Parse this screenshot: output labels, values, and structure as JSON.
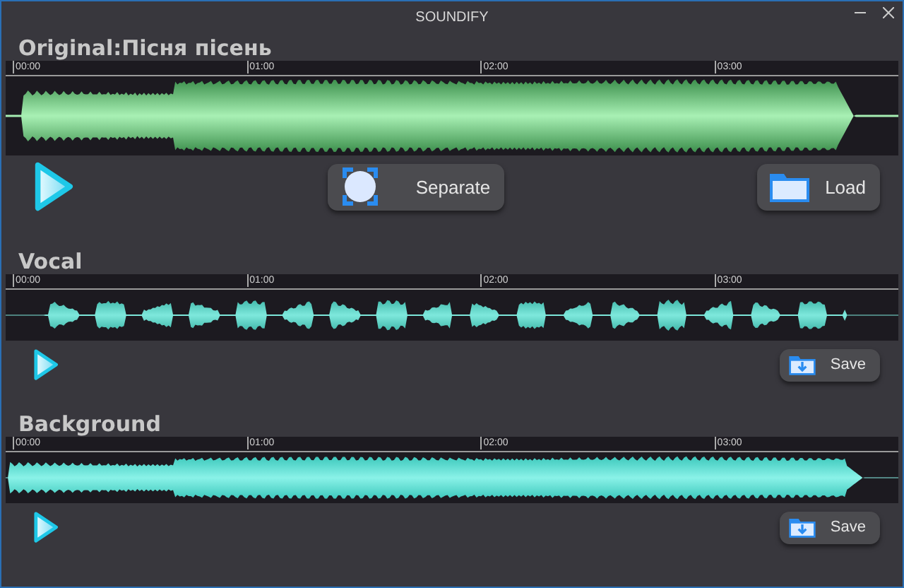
{
  "window": {
    "title": "SOUNDIFY"
  },
  "tracks": [
    {
      "kind": "original",
      "title": "Original:Пісня пісень",
      "ruler": [
        "00:00",
        "01:00",
        "02:00",
        "03:00"
      ],
      "buttons": [
        {
          "kind": "separate",
          "label": "Separate"
        },
        {
          "kind": "load",
          "label": "Load"
        }
      ]
    },
    {
      "kind": "vocal",
      "title": "Vocal",
      "ruler": [
        "00:00",
        "01:00",
        "02:00",
        "03:00"
      ],
      "buttons": [
        {
          "kind": "save",
          "label": "Save"
        }
      ]
    },
    {
      "kind": "background",
      "title": "Background",
      "ruler": [
        "00:00",
        "01:00",
        "02:00",
        "03:00"
      ],
      "buttons": [
        {
          "kind": "save",
          "label": "Save"
        }
      ]
    }
  ]
}
